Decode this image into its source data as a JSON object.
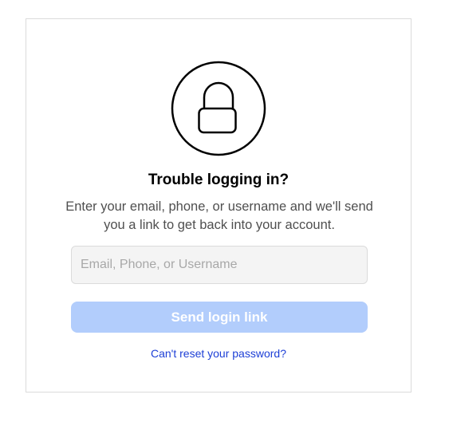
{
  "reset": {
    "lock_icon": "lock-icon",
    "title": "Trouble logging in?",
    "description": "Enter your email, phone, or username and we'll send you a link to get back into your account.",
    "input_value": "",
    "input_placeholder": "Email, Phone, or Username",
    "send_button_label": "Send login link",
    "cant_reset_link": "Can't reset your password?"
  },
  "colors": {
    "button_disabled": "#b2cdfc",
    "link": "#1d3fd6",
    "border": "#dbdbdb",
    "input_background": "#f4f4f4"
  }
}
